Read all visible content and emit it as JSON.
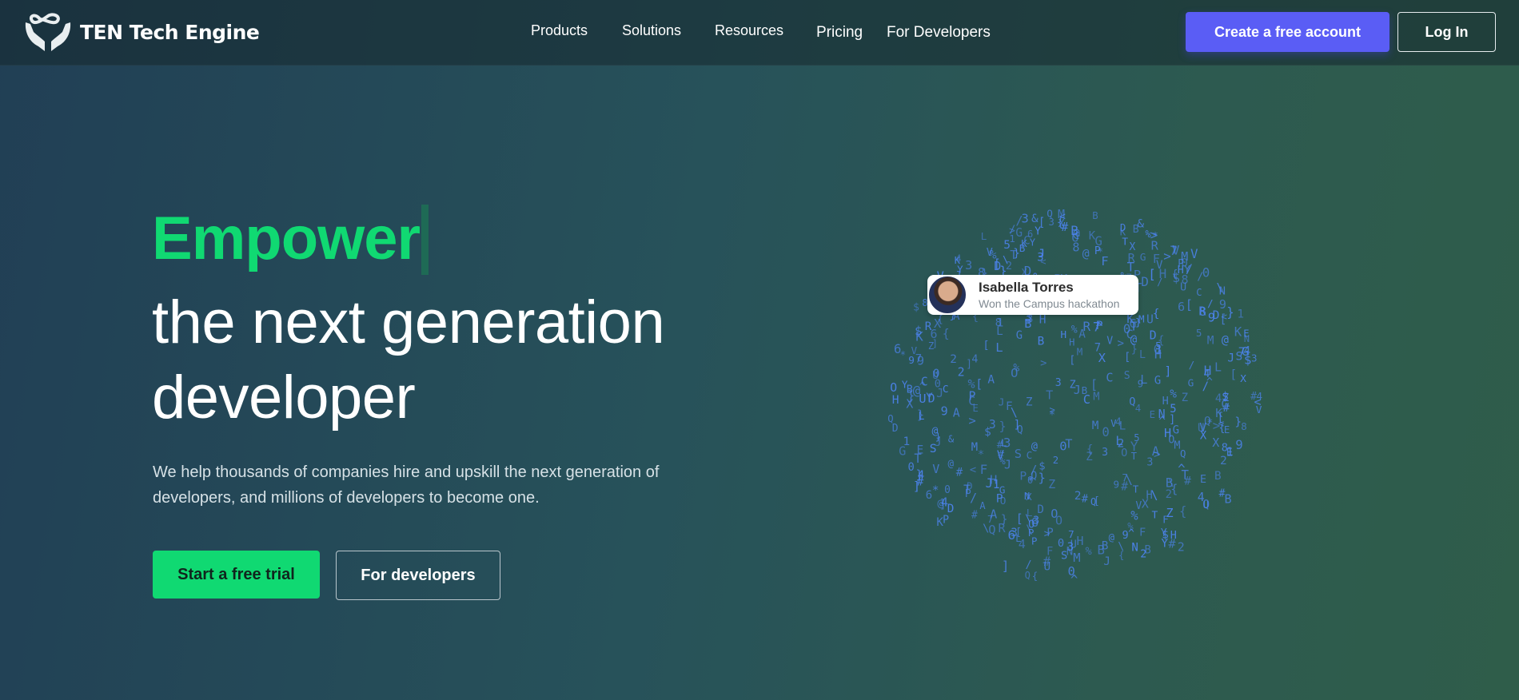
{
  "header": {
    "brand": "TEN Tech Engine",
    "logo_icon": "hands-infinity-icon",
    "nav": [
      "Products",
      "Solutions",
      "Resources",
      "Pricing",
      "For Developers"
    ],
    "create_account_label": "Create a free account",
    "login_label": "Log In"
  },
  "hero": {
    "highlight": "Empower",
    "line1": "the next generation",
    "line2": "developer",
    "subtitle": "We help thousands of companies hire and upskill the next generation of developers, and millions of developers to become one.",
    "primary_cta": "Start a free trial",
    "secondary_cta": "For developers"
  },
  "globe": {
    "glyph_color": "#4d84f0",
    "card": {
      "name": "Isabella Torres",
      "caption": "Won the Campus hackathon"
    }
  },
  "colors": {
    "accent_green": "#10d972",
    "accent_purple": "#5a5df5"
  }
}
